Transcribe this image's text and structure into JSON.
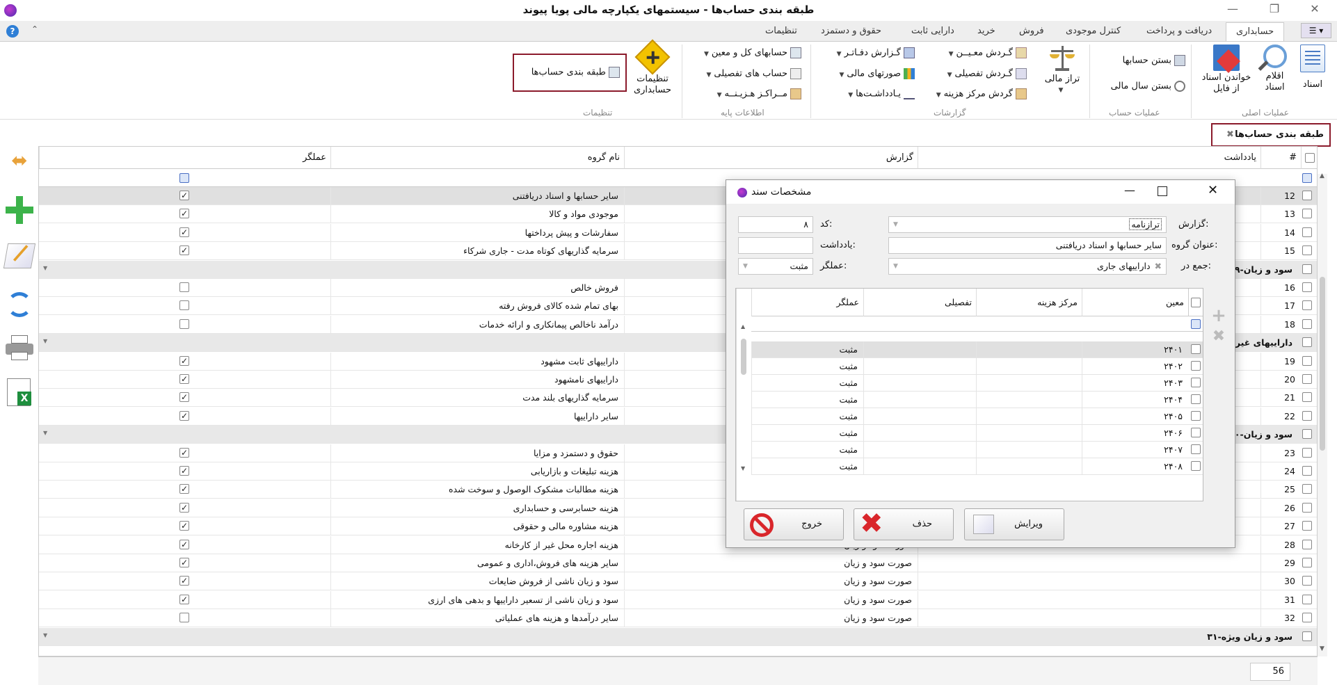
{
  "window": {
    "title": "طبقه بندی حساب‌ها - سیستمهای یکپارچه مالی پویا پیوند"
  },
  "tabs": [
    "حسابداری",
    "دریافت و پرداخت",
    "کنترل موجودی",
    "فروش",
    "خرید",
    "دارایی ثابت",
    "حقوق و دستمزد",
    "تنظیمات"
  ],
  "ribbon": {
    "groups": {
      "main_ops": "عملیات اصلی",
      "account_ops": "عملیات حساب",
      "reports": "گزارشات",
      "base_info": "اطلاعات پایه",
      "settings": "تنظیمات"
    },
    "buttons": {
      "documents": "اسناد",
      "doc_items": "اقلام",
      "doc_items2": "اسناد",
      "read_docs": "خواندن اسناد",
      "read_docs2": "از فایل",
      "close_accounts": "بستن حسابها",
      "close_year": "بستن سال مالی",
      "trial_balance": "تراز مالی",
      "moein_turnover": "گـردش معـیــن",
      "detail_turnover": "گـردش تفصیلی",
      "cost_center_turnover": "گردش مرکز هزینه",
      "ledger_report": "گـزارش دفـاتـر",
      "financial_statements": "صورتهای مالی",
      "notes": "یـادداشـت‌ها",
      "gl_accounts": "حسابهای کل و معین",
      "detail_accounts": "حساب های تفصیلی",
      "cost_centers": "مــراکـز هـزیـنــه",
      "accounting_settings": "تنظیمات",
      "accounting_settings2": "حسابداری",
      "account_classification": "طبقه بندی حساب‌ها"
    }
  },
  "doc_tab": {
    "label": "طبقه بندی حساب‌ها"
  },
  "grid": {
    "headers": {
      "num": "#",
      "note": "یادداشت",
      "report": "گزارش",
      "group_name": "نام گروه",
      "operator": "عملگر"
    },
    "rows": [
      {
        "type": "row",
        "num": "12",
        "report": "",
        "name": "سایر حسابها و اسناد دریافتنی",
        "checked": true,
        "sel": true
      },
      {
        "type": "row",
        "num": "13",
        "report": "",
        "name": "موجودی مواد و کالا",
        "checked": true
      },
      {
        "type": "row",
        "num": "14",
        "report": "",
        "name": "سفارشات و پیش پرداختها",
        "checked": true
      },
      {
        "type": "row",
        "num": "15",
        "report": "",
        "name": "سرمایه گذاریهای کوتاه مدت - جاری شرکاء",
        "checked": true
      },
      {
        "type": "group",
        "label": "۲۹-سود و زیان"
      },
      {
        "type": "row",
        "num": "16",
        "report": "",
        "name": "فروش خالص",
        "checked": false
      },
      {
        "type": "row",
        "num": "17",
        "report": "",
        "name": "بهای تمام شده کالای فروش رفته",
        "checked": false
      },
      {
        "type": "row",
        "num": "18",
        "report": "",
        "name": "درآمد ناخالص پیمانکاری و ارائه خدمات",
        "checked": false
      },
      {
        "type": "group",
        "label": "۲-داراییهای غیر جاری"
      },
      {
        "type": "row",
        "num": "19",
        "report": "",
        "name": "داراییهای ثابت مشهود",
        "checked": true
      },
      {
        "type": "row",
        "num": "20",
        "report": "",
        "name": "داراییهای نامشهود",
        "checked": true
      },
      {
        "type": "row",
        "num": "21",
        "report": "",
        "name": "سرمایه گذاریهای بلند مدت",
        "checked": true
      },
      {
        "type": "row",
        "num": "22",
        "report": "",
        "name": "سایر داراییها",
        "checked": true
      },
      {
        "type": "group",
        "label": "۳۰-سود و زیان"
      },
      {
        "type": "row",
        "num": "23",
        "report": "",
        "name": "حقوق و دستمزد و مزایا",
        "checked": true
      },
      {
        "type": "row",
        "num": "24",
        "report": "",
        "name": "هزینه تبلیغات و بازاریابی",
        "checked": true
      },
      {
        "type": "row",
        "num": "25",
        "report": "",
        "name": "هزینه مطالبات مشکوک الوصول و سوخت شده",
        "checked": true
      },
      {
        "type": "row",
        "num": "26",
        "report": "",
        "name": "هزینه حسابرسی و حسابداری",
        "checked": true
      },
      {
        "type": "row",
        "num": "27",
        "report": "",
        "name": "هزینه مشاوره مالی و حقوقی",
        "checked": true
      },
      {
        "type": "row",
        "num": "28",
        "report": "صورت سود و زیان",
        "name": "هزینه اجاره محل غیر از کارخانه",
        "checked": true
      },
      {
        "type": "row",
        "num": "29",
        "report": "صورت سود و زیان",
        "name": "سایر هزینه های فروش،اداری و عمومی",
        "checked": true
      },
      {
        "type": "row",
        "num": "30",
        "report": "صورت سود و زیان",
        "name": "سود و زیان ناشی از فروش ضایعات",
        "checked": true
      },
      {
        "type": "row",
        "num": "31",
        "report": "صورت سود و زیان",
        "name": "سود و زیان ناشی از تسعیر داراییها و بدهی های ارزی",
        "checked": true
      },
      {
        "type": "row",
        "num": "32",
        "report": "صورت سود و زیان",
        "name": "سایر درآمدها و هزینه های عملیاتی",
        "checked": false
      },
      {
        "type": "group",
        "label": "۳۱-سود و زیان ویژه"
      }
    ],
    "footer_count": "56"
  },
  "dialog": {
    "title": "مشخصات سند",
    "fields": {
      "report_label": "گزارش:",
      "report_value": "ترازنامه",
      "code_label": "کد:",
      "code_value": "۸",
      "group_title_label": "عنوان گروه:",
      "group_title_value": "سایر حسابها و اسناد دریافتنی",
      "note_label": "یادداشت:",
      "note_value": "",
      "sum_in_label": "جمع در:",
      "sum_in_value": "داراییهای جاری",
      "operator_label": "عملگر:",
      "operator_value": "مثبت"
    },
    "subgrid": {
      "headers": {
        "moein": "معین",
        "cost_center": "مرکز هزینه",
        "detail": "تفصیلی",
        "operator": "عملگر"
      },
      "rows": [
        {
          "moein": "۲۴۰۱",
          "op": "مثبت"
        },
        {
          "moein": "۲۴۰۲",
          "op": "مثبت"
        },
        {
          "moein": "۲۴۰۳",
          "op": "مثبت"
        },
        {
          "moein": "۲۴۰۴",
          "op": "مثبت"
        },
        {
          "moein": "۲۴۰۵",
          "op": "مثبت"
        },
        {
          "moein": "۲۴۰۶",
          "op": "مثبت"
        },
        {
          "moein": "۲۴۰۷",
          "op": "مثبت"
        },
        {
          "moein": "۲۴۰۸",
          "op": "مثبت"
        }
      ]
    },
    "buttons": {
      "edit": "ویرایش",
      "delete": "حذف",
      "exit": "خروج"
    }
  },
  "colors": {
    "accent": "#8b1a2b",
    "plus": "#3cb34a",
    "delete": "#d9262b"
  }
}
